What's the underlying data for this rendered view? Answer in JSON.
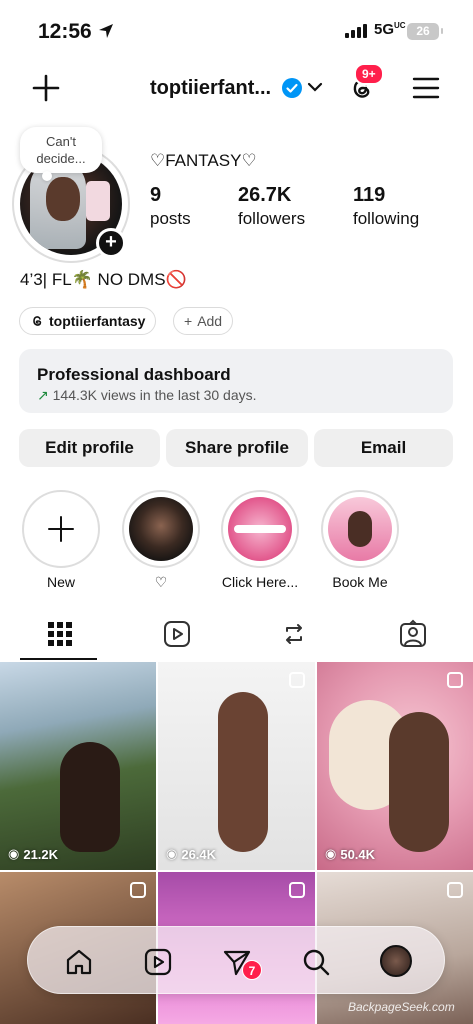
{
  "status_bar": {
    "time": "12:56",
    "network": "5G",
    "network_sup": "UC",
    "battery": "26"
  },
  "header": {
    "username": "toptiierfant...",
    "notif_count": "9+"
  },
  "profile": {
    "note": "Can't decide...",
    "display_name": "♡FANTASY♡",
    "stats": [
      {
        "value": "9",
        "label": "posts"
      },
      {
        "value": "26.7K",
        "label": "followers"
      },
      {
        "value": "119",
        "label": "following"
      }
    ],
    "bio": "4’3| FL🌴 NO DMS🚫",
    "threads_chip": "toptiierfantasy",
    "add_chip": "Add"
  },
  "dashboard": {
    "title": "Professional dashboard",
    "subtitle": "144.3K views in the last 30 days."
  },
  "actions": {
    "edit": "Edit profile",
    "share": "Share profile",
    "email": "Email"
  },
  "highlights": [
    {
      "label": "New"
    },
    {
      "label": "♡"
    },
    {
      "label": "Click Here..."
    },
    {
      "label": "Book Me"
    }
  ],
  "posts": [
    {
      "views": "21.2K"
    },
    {
      "views": "26.4K"
    },
    {
      "views": "50.4K"
    }
  ],
  "nav": {
    "dm_badge": "7"
  },
  "watermark": "BackpageSeek.com",
  "colors": {
    "accent": "#ff1f4b",
    "verified": "#0095f6",
    "growth": "#1d8a3c"
  }
}
